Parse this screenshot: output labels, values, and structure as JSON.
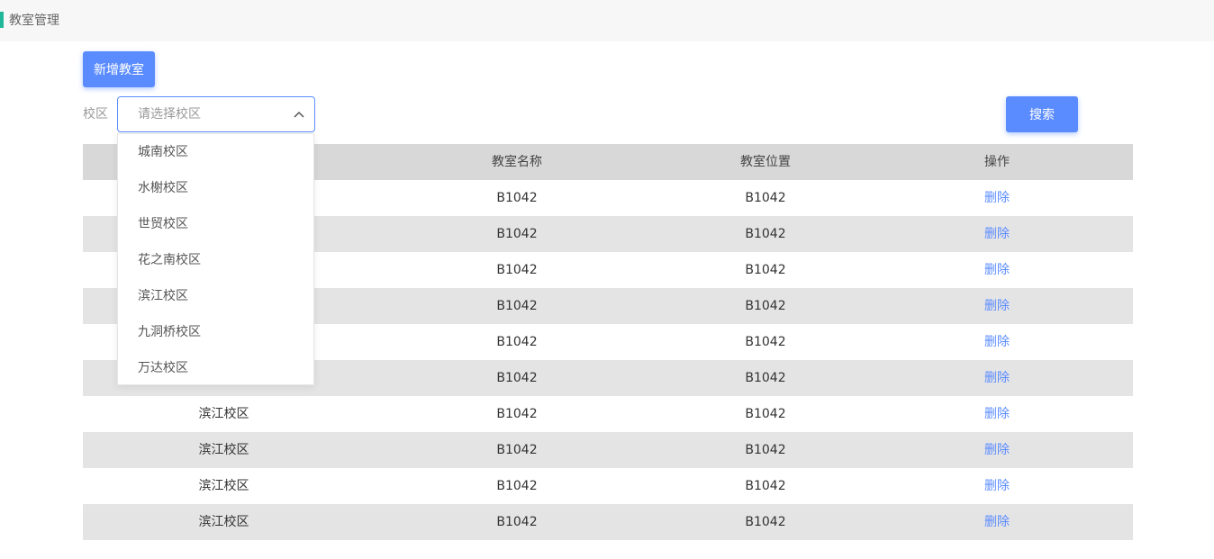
{
  "header": {
    "title": "教室管理"
  },
  "toolbar": {
    "add_label": "新增教室",
    "search_label": "搜索"
  },
  "filter": {
    "label": "校区",
    "placeholder": "请选择校区",
    "options": [
      "城南校区",
      "水榭校区",
      "世贸校区",
      "花之南校区",
      "滨江校区",
      "九洞桥校区",
      "万达校区"
    ]
  },
  "table": {
    "columns": [
      "",
      "教室名称",
      "教室位置",
      "操作"
    ],
    "rows": [
      {
        "campus": "",
        "name": "B1042",
        "location": "B1042",
        "action": "删除"
      },
      {
        "campus": "",
        "name": "B1042",
        "location": "B1042",
        "action": "删除"
      },
      {
        "campus": "",
        "name": "B1042",
        "location": "B1042",
        "action": "删除"
      },
      {
        "campus": "",
        "name": "B1042",
        "location": "B1042",
        "action": "删除"
      },
      {
        "campus": "",
        "name": "B1042",
        "location": "B1042",
        "action": "删除"
      },
      {
        "campus": "",
        "name": "B1042",
        "location": "B1042",
        "action": "删除"
      },
      {
        "campus": "滨江校区",
        "name": "B1042",
        "location": "B1042",
        "action": "删除"
      },
      {
        "campus": "滨江校区",
        "name": "B1042",
        "location": "B1042",
        "action": "删除"
      },
      {
        "campus": "滨江校区",
        "name": "B1042",
        "location": "B1042",
        "action": "删除"
      },
      {
        "campus": "滨江校区",
        "name": "B1042",
        "location": "B1042",
        "action": "删除"
      }
    ]
  },
  "colors": {
    "accent": "#5b8cff",
    "marker": "#1fb89a"
  },
  "icons": {
    "select_toggle": "chevron-up-icon"
  }
}
